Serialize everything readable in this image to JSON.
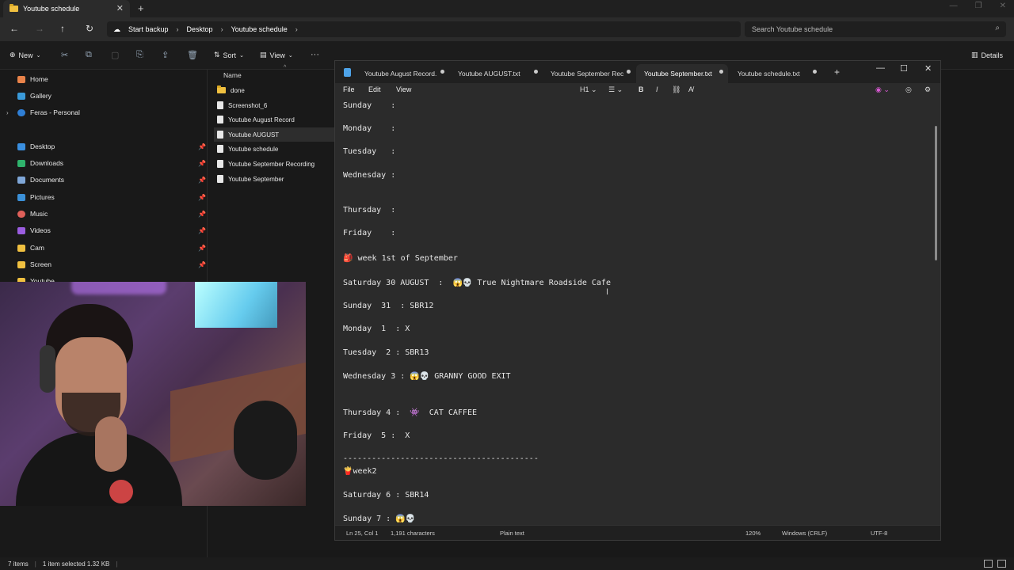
{
  "explorer": {
    "tab_title": "Youtube schedule",
    "breadcrumbs": [
      "Start backup",
      "Desktop",
      "Youtube schedule"
    ],
    "search_placeholder": "Search Youtube schedule",
    "commands": {
      "new": "New",
      "sort": "Sort",
      "view": "View",
      "details": "Details"
    },
    "nav": {
      "home": "Home",
      "gallery": "Gallery",
      "onedrive": "Feras - Personal",
      "desktop": "Desktop",
      "downloads": "Downloads",
      "documents": "Documents",
      "pictures": "Pictures",
      "music": "Music",
      "videos": "Videos",
      "cam": "Cam",
      "screen": "Screen",
      "youtube": "Youtube"
    },
    "column_name": "Name",
    "files": [
      "done",
      "Screenshot_6",
      "Youtube August Record",
      "Youtube AUGUST",
      "Youtube schedule",
      "Youtube September Recording",
      "Youtube September"
    ],
    "status": {
      "items": "7 items",
      "selected": "1 item selected  1.32 KB"
    }
  },
  "notepad": {
    "tabs": [
      "Youtube August Record.",
      "Youtube AUGUST.txt",
      "Youtube September Rec",
      "Youtube September.txt",
      "Youtube schedule.txt"
    ],
    "menu": {
      "file": "File",
      "edit": "Edit",
      "view": "View"
    },
    "heading_select": "H1",
    "lines": [
      "Sunday    :",
      "Monday    :",
      "Tuesday   :",
      "Wednesday :",
      "Thursday  :",
      "Friday    :",
      "🎒 week 1st of September",
      "Saturday 30 AUGUST  :  😱💀 True Nightmare Roadside Cafe",
      "Sunday  31  : SBR12",
      "Monday  1  : X",
      "Tuesday  2 : SBR13",
      "Wednesday 3 : 😱💀 GRANNY GOOD EXIT",
      "Thursday 4 :  👾  CAT CAFFEE",
      "Friday  5 :  X",
      "-----------------------------------------",
      "🍟week2",
      "Saturday 6 : SBR14",
      "Sunday 7 : 😱💀"
    ],
    "status": {
      "position": "Ln 25, Col 1",
      "chars": "1,191 characters",
      "type": "Plain text",
      "zoom": "120%",
      "eol": "Windows (CRLF)",
      "encoding": "UTF-8"
    }
  }
}
